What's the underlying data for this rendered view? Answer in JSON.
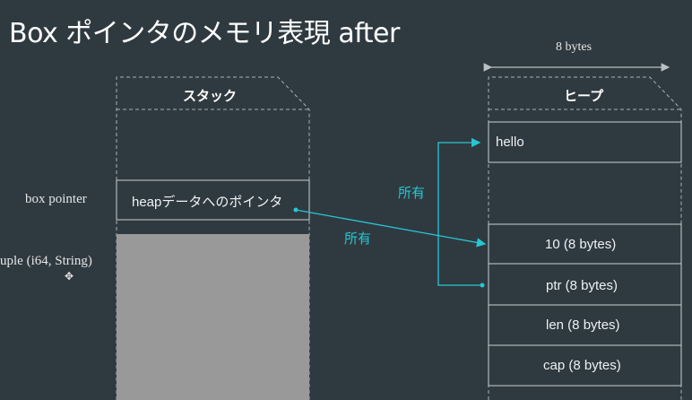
{
  "title": {
    "prefix": "Box ポインタのメモリ表現 ",
    "suffix": "after"
  },
  "width_label": "8 bytes",
  "stack": {
    "header": "スタック",
    "box_cell_text": "heapデータへのポインタ"
  },
  "heap": {
    "header": "ヒープ",
    "cells": [
      "hello",
      "10 (8 bytes)",
      "ptr (8 bytes)",
      "len (8 bytes)",
      "cap (8 bytes)"
    ]
  },
  "labels": {
    "box_pointer": "box pointer",
    "tuple": "uple (i64,  String)",
    "ownership_1": "所有",
    "ownership_2": "所有"
  },
  "colors": {
    "background": "#2f3a40",
    "arrow": "#27c6d4",
    "gray_block": "#999999"
  }
}
